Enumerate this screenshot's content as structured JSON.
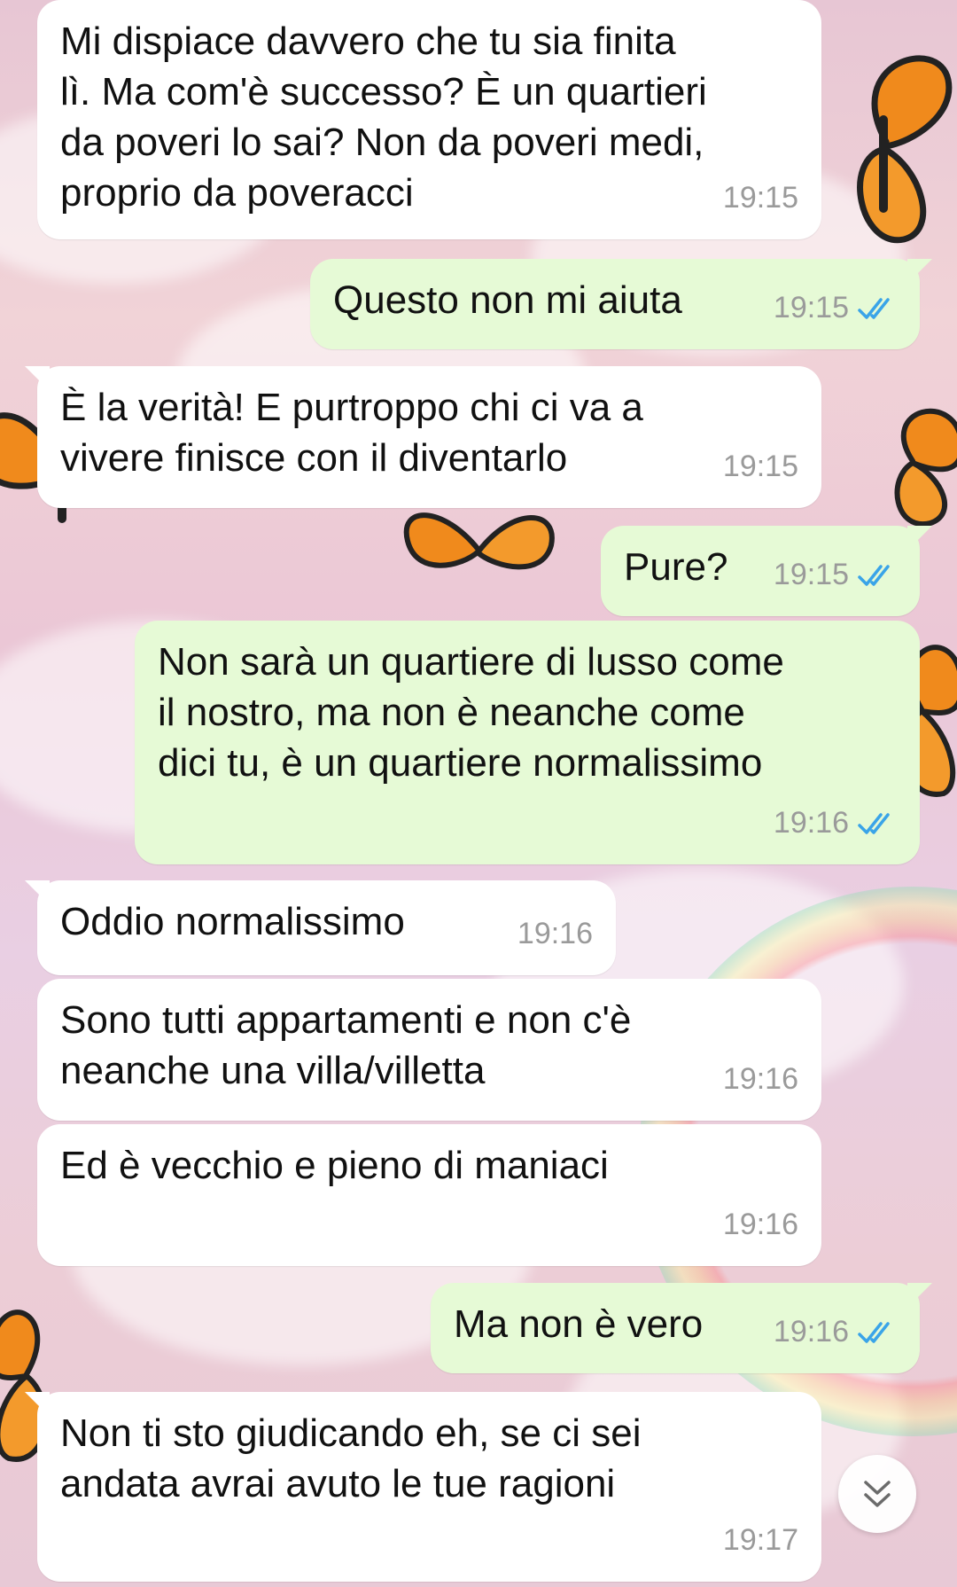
{
  "colors": {
    "incoming_bubble": "#ffffff",
    "outgoing_bubble": "#e6fad6",
    "timestamp": "#9a9a9a",
    "read_ticks": "#3aa4e8"
  },
  "messages": [
    {
      "direction": "incoming",
      "text": "Mi dispiace davvero che tu sia finita\nlì. Ma com'è successo? È un quartieri\nda poveri lo sai? Non da poveri medi,\nproprio da poveracci",
      "time": "19:15"
    },
    {
      "direction": "outgoing",
      "text": "Questo non mi aiuta",
      "time": "19:15",
      "status": "read"
    },
    {
      "direction": "incoming",
      "text": "È la verità! E purtroppo chi ci va a\nvivere finisce con il diventarlo",
      "time": "19:15"
    },
    {
      "direction": "outgoing",
      "text": "Pure?",
      "time": "19:15",
      "status": "read"
    },
    {
      "direction": "outgoing",
      "text": "Non sarà un quartiere di lusso come\nil nostro, ma non è neanche come\ndici tu, è un quartiere normalissimo",
      "time": "19:16",
      "status": "read"
    },
    {
      "direction": "incoming",
      "text": "Oddio normalissimo",
      "time": "19:16"
    },
    {
      "direction": "incoming",
      "text": "Sono tutti appartamenti e non c'è\nneanche una villa/villetta",
      "time": "19:16"
    },
    {
      "direction": "incoming",
      "text": "Ed è vecchio e pieno di maniaci",
      "time": "19:16"
    },
    {
      "direction": "outgoing",
      "text": "Ma non è vero",
      "time": "19:16",
      "status": "read"
    },
    {
      "direction": "incoming",
      "text": "Non ti sto giudicando eh, se ci sei\nandata avrai avuto le tue ragioni",
      "time": "19:17"
    }
  ],
  "icons": {
    "read_receipt": "double-check-icon",
    "scroll_down": "chevron-double-down-icon"
  }
}
